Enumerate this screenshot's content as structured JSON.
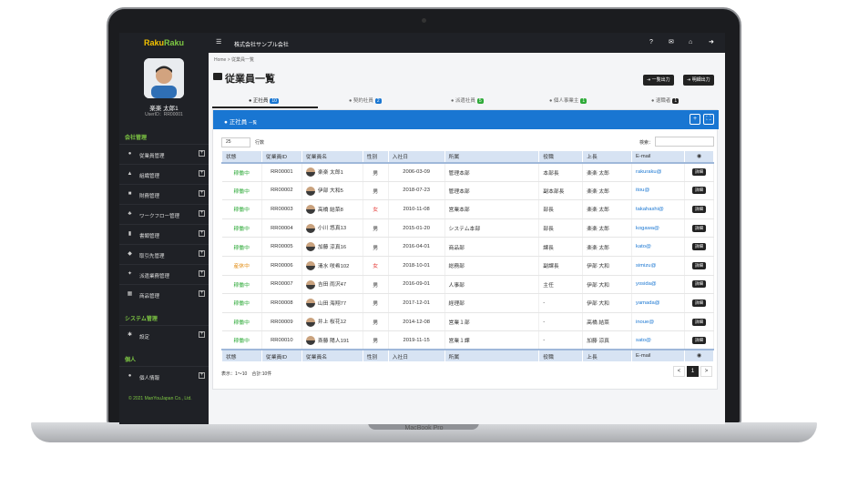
{
  "app": {
    "logo_a": "Raku",
    "logo_b": "Raku",
    "company": "株式会社サンプル会社"
  },
  "user": {
    "name": "楽楽 太郎1",
    "id": "UserID：RR00001"
  },
  "sidebar": {
    "sections": [
      {
        "label": "会社管理"
      },
      {
        "label": "システム管理"
      },
      {
        "label": "個人"
      }
    ],
    "items": [
      {
        "label": "従業員管理",
        "icon": "user-icon"
      },
      {
        "label": "組織管理",
        "icon": "organization-icon"
      },
      {
        "label": "財務管理",
        "icon": "finance-icon"
      },
      {
        "label": "ワークフロー管理",
        "icon": "workflow-icon"
      },
      {
        "label": "書類管理",
        "icon": "document-icon"
      },
      {
        "label": "取引先管理",
        "icon": "handshake-icon"
      },
      {
        "label": "派遣業務管理",
        "icon": "dispatch-icon"
      },
      {
        "label": "商品管理",
        "icon": "product-icon"
      },
      {
        "label": "設定",
        "icon": "gear-icon"
      },
      {
        "label": "個人情報",
        "icon": "person-icon"
      }
    ],
    "copyright": "© 2021 ManYouJapan Co., Ltd."
  },
  "breadcrumb": {
    "home": "Home",
    "sep": ">",
    "current": "従業員一覧"
  },
  "page": {
    "title": "従業員一覧",
    "export_list": "一覧出力",
    "export_detail": "明細出力"
  },
  "tabs": [
    {
      "label": "正社員",
      "count": "10"
    },
    {
      "label": "契約社員",
      "count": "2"
    },
    {
      "label": "派遣社員",
      "count": "5"
    },
    {
      "label": "個人事業主",
      "count": "1"
    },
    {
      "label": "退職者",
      "count": "1"
    }
  ],
  "panel": {
    "title": "正社員",
    "subtitle": "一覧",
    "page_len": "25",
    "page_len_suffix": "行数",
    "search_label": "検索："
  },
  "table": {
    "columns": [
      "状態",
      "従業員ID",
      "従業員名",
      "性別",
      "入社日",
      "所属",
      "役職",
      "上長",
      "E-mail"
    ],
    "rows": [
      {
        "status": "稼働中",
        "id": "RR00001",
        "name": "楽楽 太郎1",
        "gender": "男",
        "date": "2006-03-09",
        "dept": "管理本部",
        "role": "本部長",
        "boss": "楽楽 太郎",
        "mail": "rakuraku@"
      },
      {
        "status": "稼働中",
        "id": "RR00002",
        "name": "伊部 大和5",
        "gender": "男",
        "date": "2018-07-23",
        "dept": "管理本部",
        "role": "副本部長",
        "boss": "楽楽 太郎",
        "mail": "itou@"
      },
      {
        "status": "稼働中",
        "id": "RR00003",
        "name": "高橋 結菜8",
        "gender": "女",
        "date": "2010-11-08",
        "dept": "営業本部",
        "role": "部長",
        "boss": "楽楽 太郎",
        "mail": "takahashi@"
      },
      {
        "status": "稼働中",
        "id": "RR00004",
        "name": "小川 悠真13",
        "gender": "男",
        "date": "2015-01-20",
        "dept": "システム本部",
        "role": "部長",
        "boss": "楽楽 太郎",
        "mail": "kogawa@"
      },
      {
        "status": "稼働中",
        "id": "RR00005",
        "name": "加藤 涼真16",
        "gender": "男",
        "date": "2016-04-01",
        "dept": "商品部",
        "role": "課長",
        "boss": "楽楽 太郎",
        "mail": "kato@"
      },
      {
        "status": "産休中",
        "id": "RR00006",
        "name": "清水 咲希102",
        "gender": "女",
        "date": "2018-10-01",
        "dept": "総務部",
        "role": "副課長",
        "boss": "伊部 大和",
        "mail": "simizu@"
      },
      {
        "status": "稼働中",
        "id": "RR00007",
        "name": "吉田 雨沢47",
        "gender": "男",
        "date": "2016-09-01",
        "dept": "人事部",
        "role": "主任",
        "boss": "伊部 大和",
        "mail": "yosida@"
      },
      {
        "status": "稼働中",
        "id": "RR00008",
        "name": "山田 海翔77",
        "gender": "男",
        "date": "2017-12-01",
        "dept": "経理部",
        "role": "-",
        "boss": "伊部 大和",
        "mail": "yamada@"
      },
      {
        "status": "稼働中",
        "id": "RR00009",
        "name": "井上 桜花12",
        "gender": "男",
        "date": "2014-12-08",
        "dept": "営業１部",
        "role": "-",
        "boss": "高橋 結菜",
        "mail": "inoue@"
      },
      {
        "status": "稼働中",
        "id": "RR00010",
        "name": "斎藤 陽人191",
        "gender": "男",
        "date": "2019-11-15",
        "dept": "営業１課",
        "role": "-",
        "boss": "加藤 涼真",
        "mail": "sato@"
      }
    ],
    "detail_label": "詳細"
  },
  "footer": {
    "info": "表示：1～10　合計:10件",
    "page": "1",
    "prev": "<",
    "next": ">"
  },
  "device": {
    "label": "MacBook Pro"
  },
  "colors": {
    "accent": "#1976d2",
    "active": "#2eaa39",
    "leave": "#e28c12",
    "female": "#e53935"
  }
}
